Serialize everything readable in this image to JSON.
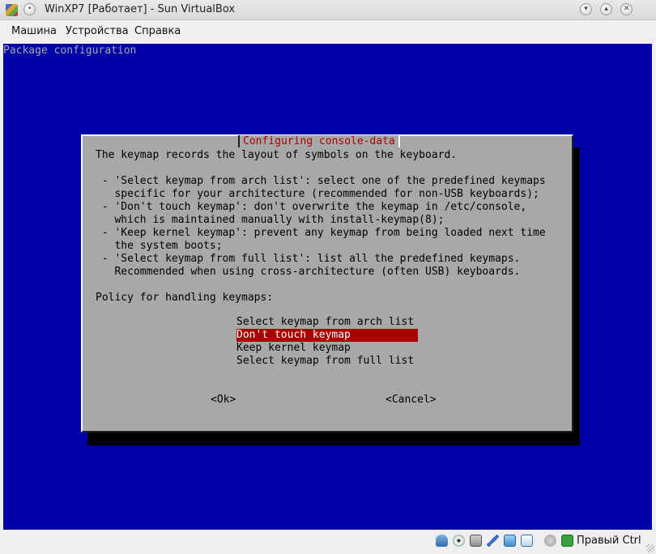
{
  "window": {
    "title": "WinXP7 [Работает] - Sun VirtualBox"
  },
  "menu": {
    "items": [
      {
        "label": "Машина"
      },
      {
        "label": "Устройства"
      },
      {
        "label": "Справка"
      }
    ]
  },
  "screen": {
    "header": "Package configuration",
    "dialog": {
      "title": "Configuring console-data",
      "lines": [
        "The keymap records the layout of symbols on the keyboard.",
        " - 'Select keymap from arch list': select one of the predefined keymaps",
        "   specific for your architecture (recommended for non-USB keyboards);",
        " - 'Don't touch keymap': don't overwrite the keymap in /etc/console,",
        "   which is maintained manually with install-keymap(8);",
        " - 'Keep kernel keymap': prevent any keymap from being loaded next time",
        "   the system boots;",
        " - 'Select keymap from full list': list all the predefined keymaps.",
        "   Recommended when using cross-architecture (often USB) keyboards."
      ],
      "prompt": "Policy for handling keymaps:",
      "options": [
        "Select keymap from arch list",
        "Don't touch keymap",
        "Keep kernel keymap",
        "Select keymap from full list"
      ],
      "selected_option": "Don't touch keymap",
      "ok_label": "<Ok>",
      "cancel_label": "<Cancel>"
    }
  },
  "statusbar": {
    "host_key": "Правый Ctrl",
    "icons": [
      "hard-disk-icon",
      "cd-icon",
      "floppy-icon",
      "usb-icon",
      "shared-folders-icon",
      "network-icon",
      "mouse-integration-icon",
      "capture-arrow-icon"
    ]
  },
  "colors": {
    "vm_background": "#0000a8",
    "dialog_background": "#a8a8a8",
    "accent_red": "#a80000"
  }
}
